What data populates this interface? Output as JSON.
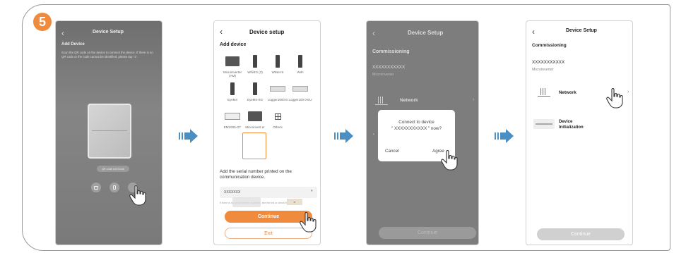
{
  "step_number": "5",
  "colors": {
    "accent": "#f08a3c",
    "arrow": "#4a8ec2"
  },
  "screen1": {
    "title": "Device Setup",
    "heading": "Add Device",
    "instructions": "Scan the QR code on the device to connect the device. If there is no QR code or the code cannot be identified, please tap \"1\".",
    "manual_label": "QR code not found",
    "icons": [
      "album-icon",
      "flashlight-icon",
      "keyboard-icon"
    ]
  },
  "screen2": {
    "title": "Device setup",
    "heading": "Add device",
    "devices": [
      {
        "label": "Microinverter (AM)",
        "icon": "microinverter-icon"
      },
      {
        "label": "Wifi/4G (3)",
        "icon": "stick-icon"
      },
      {
        "label": "WiNet-S",
        "icon": "stick-icon"
      },
      {
        "label": "WiFi",
        "icon": "stick-icon"
      },
      {
        "label": "EyeM4",
        "icon": "stick-icon"
      },
      {
        "label": "EyeM4-SG",
        "icon": "stick-icon"
      },
      {
        "label": "Logger1000 B",
        "icon": "logger-icon"
      },
      {
        "label": "Logger100 0-EU",
        "icon": "logger-icon"
      },
      {
        "label": "EM1000-GT",
        "icon": "meter-icon"
      },
      {
        "label": "Microinvert er",
        "icon": "microinverter-icon"
      },
      {
        "label": "Others",
        "icon": "grid-icon"
      }
    ],
    "serial_prompt": "Add the serial number printed on the communication device.",
    "serial_value": "XXXXXXX",
    "hint": "If there is no serial number available, see the ind or check the number",
    "continue_label": "Continue",
    "exit_label": "Exit"
  },
  "screen3": {
    "title": "Device Setup",
    "heading": "Commissioning",
    "device_sn": "XXXXXXXXXXX",
    "device_type": "Microinverter",
    "network_label": "Network",
    "dialog_text_line1": "Connect to device",
    "dialog_text_line2": "\" XXXXXXXXXXX \" now?",
    "cancel_label": "Cancel",
    "agree_label": "Agree",
    "continue_label": "Continue"
  },
  "screen4": {
    "title": "Device Setup",
    "heading": "Commissioning",
    "device_sn": "XXXXXXXXXXX",
    "device_type": "Microinverter",
    "network_label": "Network",
    "init_label_1": "Device",
    "init_label_2": "Initialization",
    "continue_label": "Continue"
  }
}
